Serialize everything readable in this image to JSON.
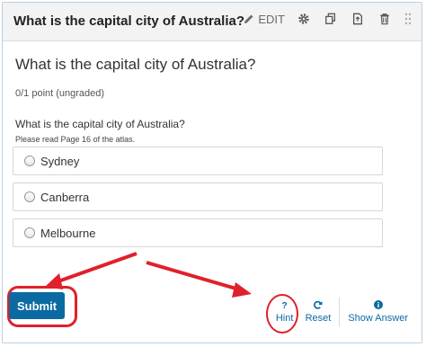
{
  "header": {
    "title": "What is the capital city of Australia?",
    "edit_label": "EDIT",
    "icons": [
      "pencil-icon",
      "gear-icon",
      "duplicate-icon",
      "export-icon",
      "trash-icon",
      "drag-handle-icon"
    ]
  },
  "problem": {
    "title": "What is the capital city of Australia?",
    "points": "0/1 point (ungraded)",
    "question": "What is the capital city of Australia?",
    "hint_text": "Please read Page 16 of the atlas.",
    "options": [
      {
        "label": "Sydney"
      },
      {
        "label": "Canberra"
      },
      {
        "label": "Melbourne"
      }
    ]
  },
  "actions": {
    "submit_label": "Submit",
    "hint_label": "Hint",
    "hint_glyph": "?",
    "reset_label": "Reset",
    "show_answer_label": "Show Answer"
  },
  "colors": {
    "accent": "#0b6aa2",
    "annotation": "#e0202a"
  }
}
